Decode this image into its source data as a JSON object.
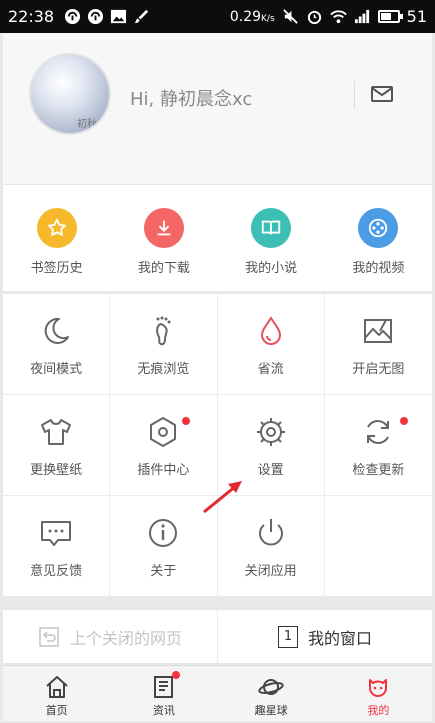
{
  "status_bar": {
    "time": "22:38",
    "net_speed": "0.29",
    "net_unit": "K/s",
    "battery": "51",
    "icons": [
      "notification-icon",
      "notification-icon",
      "image-icon",
      "brush-icon",
      "mute-icon",
      "alarm-icon",
      "wifi-icon",
      "signal-icon",
      "battery-icon"
    ]
  },
  "profile": {
    "avatar_text": "初秋",
    "greeting": "Hi, 静初晨念xc",
    "mail_icon": "mail-icon"
  },
  "top_items": [
    {
      "label": "书签历史",
      "icon": "star-icon",
      "color": "#f6b92b"
    },
    {
      "label": "我的下载",
      "icon": "download-icon",
      "color": "#f46766"
    },
    {
      "label": "我的小说",
      "icon": "book-icon",
      "color": "#3cbfb4"
    },
    {
      "label": "我的视频",
      "icon": "film-reel-icon",
      "color": "#4a9de5"
    }
  ],
  "grid_items": [
    {
      "label": "夜间模式",
      "icon": "moon-icon"
    },
    {
      "label": "无痕浏览",
      "icon": "footprint-icon"
    },
    {
      "label": "省流",
      "icon": "drop-icon",
      "color": "#e9515b"
    },
    {
      "label": "开启无图",
      "icon": "no-image-icon"
    },
    {
      "label": "更换壁纸",
      "icon": "tshirt-icon"
    },
    {
      "label": "插件中心",
      "icon": "hexagon-icon",
      "badge": true
    },
    {
      "label": "设置",
      "icon": "gear-icon"
    },
    {
      "label": "检查更新",
      "icon": "refresh-icon",
      "badge": true
    },
    {
      "label": "意见反馈",
      "icon": "chat-icon"
    },
    {
      "label": "关于",
      "icon": "info-icon"
    },
    {
      "label": "关闭应用",
      "icon": "power-icon"
    },
    {
      "label": "",
      "icon": ""
    }
  ],
  "actions": {
    "prev_label": "上个关闭的网页",
    "window_label": "我的窗口",
    "window_count": "1"
  },
  "tabs": [
    {
      "label": "首页",
      "icon": "home-icon"
    },
    {
      "label": "资讯",
      "icon": "news-icon",
      "badge": true
    },
    {
      "label": "趣星球",
      "icon": "planet-icon"
    },
    {
      "label": "我的",
      "icon": "profile-icon",
      "active": true
    }
  ],
  "colors": {
    "accent": "#f2333e",
    "icon_gray": "#666666"
  }
}
